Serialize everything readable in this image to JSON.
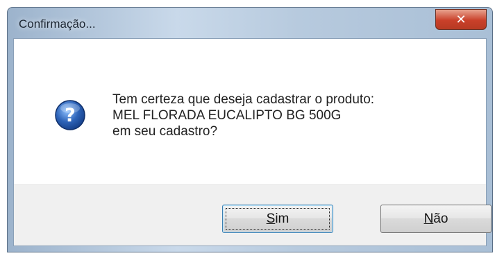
{
  "window": {
    "title": "Confirmação...",
    "close_glyph": "✕"
  },
  "dialog": {
    "icon": "question-icon",
    "message_lines": [
      "Tem certeza que deseja cadastrar o produto:",
      "MEL FLORADA EUCALIPTO BG 500G",
      "em seu cadastro?"
    ]
  },
  "buttons": {
    "yes": {
      "accel": "S",
      "rest": "im"
    },
    "no": {
      "accel": "N",
      "rest": "ão"
    }
  },
  "colors": {
    "titlebar_accent": "#b7cade",
    "close_red": "#c9402a",
    "question_blue": "#2d63b8",
    "focus_border": "#3c7fb1"
  }
}
